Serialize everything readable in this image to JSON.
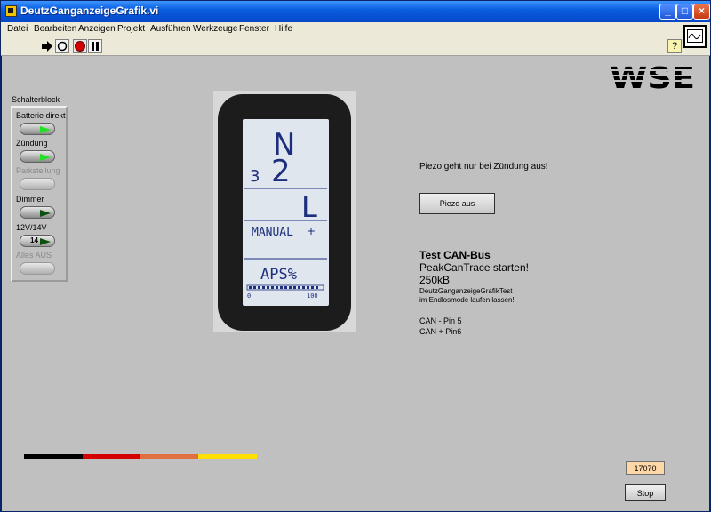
{
  "window": {
    "title": "DeutzGanganzeigeGrafik.vi",
    "minimize": "_",
    "maximize": "□",
    "close": "×"
  },
  "menu": [
    "Datei",
    "Bearbeiten",
    "Anzeigen",
    "Projekt",
    "Ausführen",
    "Werkzeuge",
    "Fenster",
    "Hilfe"
  ],
  "toolbar": {
    "run_icon": "run-arrow-icon",
    "continuous_icon": "run-continuous-icon",
    "abort_icon": "abort-stop-icon",
    "pause_icon": "pause-icon",
    "help_icon": "context-help-icon",
    "help_label": "?"
  },
  "logo": {
    "text": "WSE"
  },
  "schalterblock": {
    "title": "Schalterblock",
    "items": [
      {
        "label": "Batterie direkt",
        "state": "on"
      },
      {
        "label": "Zündung",
        "state": "on"
      },
      {
        "label": "Parkstellung",
        "state": "disabled"
      },
      {
        "label": "Dimmer",
        "state": "off"
      },
      {
        "label": "12V/14V",
        "state": "off",
        "value": "14"
      },
      {
        "label": "Alles AUS",
        "state": "disabled"
      }
    ]
  },
  "display": {
    "mode_top": "N",
    "gear": "2",
    "gear_small": "3",
    "range": "L",
    "manual": "MANUAL",
    "plus": "+",
    "aps": "APS%",
    "scale_min": "0",
    "scale_max": "100"
  },
  "piezo": {
    "message": "Piezo geht nur bei Zündung aus!",
    "button": "Piezo aus"
  },
  "can": {
    "title": "Test CAN-Bus",
    "line1": "PeakCanTrace starten!",
    "line2": "250kB",
    "line3": "DeutzGanganzeigeGrafikTest",
    "line4": "im Endlosmode laufen lassen!",
    "pin_minus": "CAN - Pin 5",
    "pin_plus": "CAN + Pin6"
  },
  "counter": {
    "value": "17070"
  },
  "stop_button": {
    "label": "Stop"
  },
  "colors": {
    "bar": [
      "#000000",
      "#d40000",
      "#e07040",
      "#ffe000"
    ],
    "title_blue": "#0a5fe0",
    "led_on": "#22e022",
    "counter_bg": "#fdd7a6"
  }
}
